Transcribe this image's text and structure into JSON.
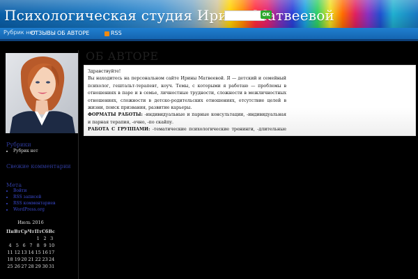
{
  "header": {
    "site_title": "Психологическая студия Ирины Матвеевой",
    "search_button": "OK"
  },
  "nav": {
    "rubrics_placeholder": "Рубрик нет",
    "items": [
      {
        "label": "ОТЗЫВЫ"
      },
      {
        "label": "ОБ АВТОРЕ"
      },
      {
        "label": "RSS"
      }
    ]
  },
  "page": {
    "heading": "ОБ АВТОРЕ",
    "greeting": "Здравствуйте!",
    "intro": "Вы находитесь на персональном сайте Ирины Матвеевой. Я — детский и семейный психолог, гештальт-терапевт, коуч. Темы, с которыми я работаю — проблемы в отношениях в паре и в семье, личностные трудности, сложности в межличностных отношениях, сложности в детско-родительских отношениях, отсутствие целей в жизни, поиск призвания, развитие карьеры.",
    "formats_label": "ФОРМАТЫ РАБОТЫ:",
    "formats_text": " -индивидуальные и парные консультации, -индивидуальная и парная терапия, -очно, -по скайпу.",
    "groups_label": "РАБОТА С ГРУППАМИ:",
    "groups_text": " -тематические психологические тренинги, -длительные терапевтические группы."
  },
  "sidebar": {
    "rubrics_title": "Рубрики",
    "rubrics_items": [
      "Рубрик нет"
    ],
    "comments_title": "Свежие комментарии",
    "meta_title": "Мета",
    "meta_items": [
      "Войти",
      "RSS записей",
      "RSS комментариев",
      "WordPress.org"
    ]
  },
  "calendar": {
    "caption": "Июль 2016",
    "weekdays": [
      "Пн",
      "Вт",
      "Ср",
      "Чт",
      "Пт",
      "Сб",
      "Вс"
    ],
    "rows": [
      [
        "",
        "",
        "",
        "",
        "1",
        "2",
        "3"
      ],
      [
        "4",
        "5",
        "6",
        "7",
        "8",
        "9",
        "10"
      ],
      [
        "11",
        "12",
        "13",
        "14",
        "15",
        "16",
        "17"
      ],
      [
        "18",
        "19",
        "20",
        "21",
        "22",
        "23",
        "24"
      ],
      [
        "25",
        "26",
        "27",
        "28",
        "29",
        "30",
        "31"
      ]
    ]
  },
  "colors": {
    "nav_blue": "#1f7fd0",
    "link_blue": "#3a4ad0",
    "widget_title": "#2e3a9a",
    "ok_green": "#2ea82e",
    "rss_orange": "#f08a10"
  },
  "icons": {
    "rss": "rss-icon"
  }
}
